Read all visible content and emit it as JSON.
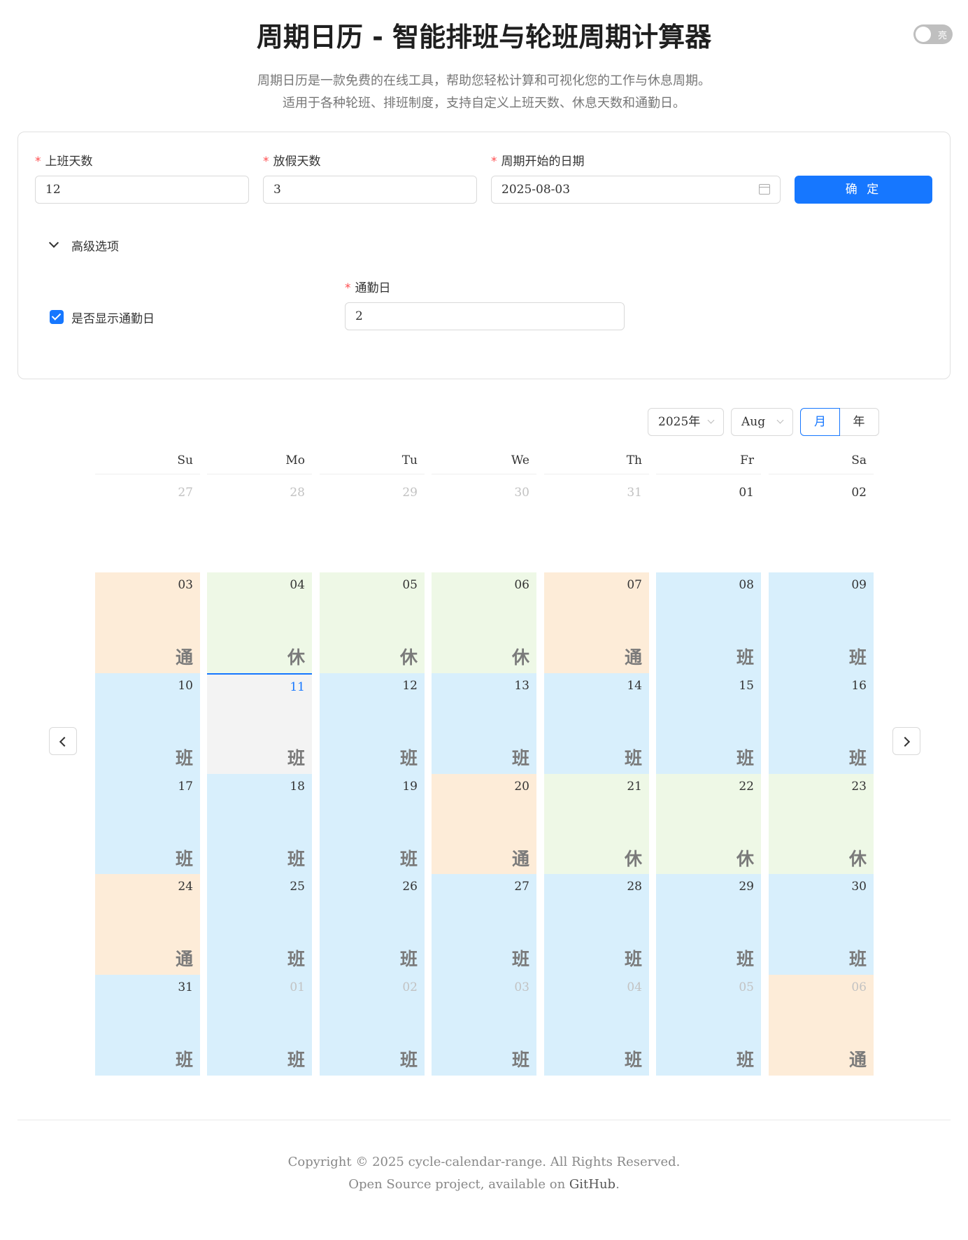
{
  "header": {
    "title": "周期日历 - 智能排班与轮班周期计算器",
    "theme_toggle_label": "亮",
    "desc_line1": "周期日历是一款免费的在线工具，帮助您轻松计算和可视化您的工作与休息周期。",
    "desc_line2": "适用于各种轮班、排班制度，支持自定义上班天数、休息天数和通勤日。"
  },
  "form": {
    "work_days_label": "上班天数",
    "work_days_value": "12",
    "rest_days_label": "放假天数",
    "rest_days_value": "3",
    "start_date_label": "周期开始的日期",
    "start_date_value": "2025-08-03",
    "required_mark": "*",
    "submit_label": "确 定",
    "advanced_label": "高级选项",
    "show_commute_label": "是否显示通勤日",
    "show_commute_checked": true,
    "commute_days_label": "通勤日",
    "commute_days_value": "2"
  },
  "calendar_header": {
    "year_select": "2025年",
    "month_select": "Aug",
    "mode_month": "月",
    "mode_year": "年",
    "active_mode": "month"
  },
  "weekdays": [
    "Su",
    "Mo",
    "Tu",
    "We",
    "Th",
    "Fr",
    "Sa"
  ],
  "status_labels": {
    "work": "班",
    "rest": "休",
    "commute": "通"
  },
  "weeks": [
    [
      {
        "day": "27",
        "state": "blank"
      },
      {
        "day": "28",
        "state": "blank"
      },
      {
        "day": "29",
        "state": "blank"
      },
      {
        "day": "30",
        "state": "blank"
      },
      {
        "day": "31",
        "state": "blank"
      },
      {
        "day": "01",
        "state": "blank-in"
      },
      {
        "day": "02",
        "state": "blank-in"
      }
    ],
    [
      {
        "day": "03",
        "state": "comm"
      },
      {
        "day": "04",
        "state": "rest"
      },
      {
        "day": "05",
        "state": "rest"
      },
      {
        "day": "06",
        "state": "rest"
      },
      {
        "day": "07",
        "state": "comm"
      },
      {
        "day": "08",
        "state": "work"
      },
      {
        "day": "09",
        "state": "work"
      }
    ],
    [
      {
        "day": "10",
        "state": "work"
      },
      {
        "day": "11",
        "state": "work",
        "today": true
      },
      {
        "day": "12",
        "state": "work"
      },
      {
        "day": "13",
        "state": "work"
      },
      {
        "day": "14",
        "state": "work"
      },
      {
        "day": "15",
        "state": "work"
      },
      {
        "day": "16",
        "state": "work"
      }
    ],
    [
      {
        "day": "17",
        "state": "work"
      },
      {
        "day": "18",
        "state": "work"
      },
      {
        "day": "19",
        "state": "work"
      },
      {
        "day": "20",
        "state": "comm"
      },
      {
        "day": "21",
        "state": "rest"
      },
      {
        "day": "22",
        "state": "rest"
      },
      {
        "day": "23",
        "state": "rest"
      }
    ],
    [
      {
        "day": "24",
        "state": "comm"
      },
      {
        "day": "25",
        "state": "work"
      },
      {
        "day": "26",
        "state": "work"
      },
      {
        "day": "27",
        "state": "work"
      },
      {
        "day": "28",
        "state": "work"
      },
      {
        "day": "29",
        "state": "work"
      },
      {
        "day": "30",
        "state": "work"
      }
    ],
    [
      {
        "day": "31",
        "state": "work"
      },
      {
        "day": "01",
        "state": "work",
        "other": true
      },
      {
        "day": "02",
        "state": "work",
        "other": true
      },
      {
        "day": "03",
        "state": "work",
        "other": true
      },
      {
        "day": "04",
        "state": "work",
        "other": true
      },
      {
        "day": "05",
        "state": "work",
        "other": true
      },
      {
        "day": "06",
        "state": "comm",
        "other": true
      }
    ]
  ],
  "footer": {
    "copyright": "Copyright © 2025 cycle-calendar-range. All Rights Reserved.",
    "opensource_prefix": "Open Source project, available on ",
    "github_link": "GitHub",
    "opensource_suffix": "."
  }
}
